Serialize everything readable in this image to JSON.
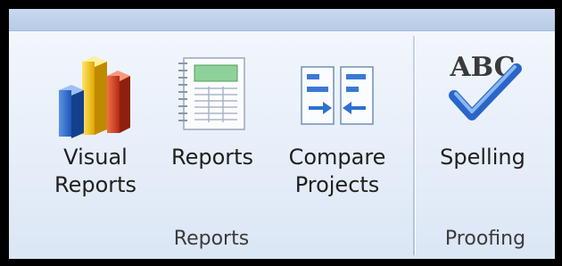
{
  "ribbon": {
    "groups": [
      {
        "label": "Reports",
        "buttons": [
          {
            "label": "Visual\nReports",
            "icon": "bar-chart-icon"
          },
          {
            "label": "Reports",
            "icon": "report-page-icon"
          },
          {
            "label": "Compare\nProjects",
            "icon": "compare-projects-icon"
          }
        ]
      },
      {
        "label": "Proofing",
        "buttons": [
          {
            "label": "Spelling",
            "icon": "abc-checkmark-icon"
          }
        ]
      }
    ]
  },
  "colors": {
    "ribbon_bg": "#e4ecf7",
    "accent_blue": "#2f6fd0",
    "bar_yellow": "#f3c21a",
    "bar_red": "#d8401f"
  }
}
